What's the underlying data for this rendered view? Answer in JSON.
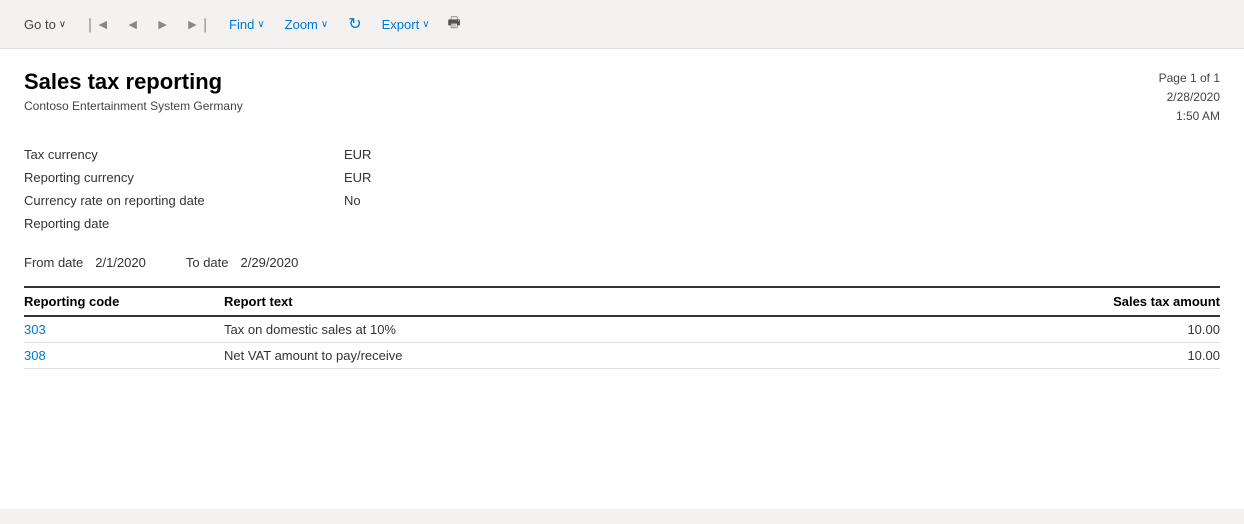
{
  "toolbar": {
    "goto_label": "Go to",
    "find_label": "Find",
    "zoom_label": "Zoom",
    "export_label": "Export",
    "chevron": "∨"
  },
  "report": {
    "title": "Sales tax reporting",
    "company": "Contoso Entertainment System Germany",
    "page_info_line1": "Page 1 of 1",
    "page_info_line2": "2/28/2020",
    "page_info_line3": "1:50 AM",
    "fields": [
      {
        "label": "Tax currency",
        "value": "EUR"
      },
      {
        "label": "Reporting currency",
        "value": "EUR"
      },
      {
        "label": "Currency rate on reporting date",
        "value": "No"
      },
      {
        "label": "Reporting date",
        "value": ""
      }
    ],
    "from_date_label": "From date",
    "from_date_value": "2/1/2020",
    "to_date_label": "To date",
    "to_date_value": "2/29/2020",
    "table": {
      "col_code": "Reporting code",
      "col_text": "Report text",
      "col_amount": "Sales tax amount",
      "rows": [
        {
          "code": "303",
          "text": "Tax on domestic sales at 10%",
          "amount": "10.00"
        },
        {
          "code": "308",
          "text": "Net VAT amount to pay/receive",
          "amount": "10.00"
        }
      ]
    }
  }
}
